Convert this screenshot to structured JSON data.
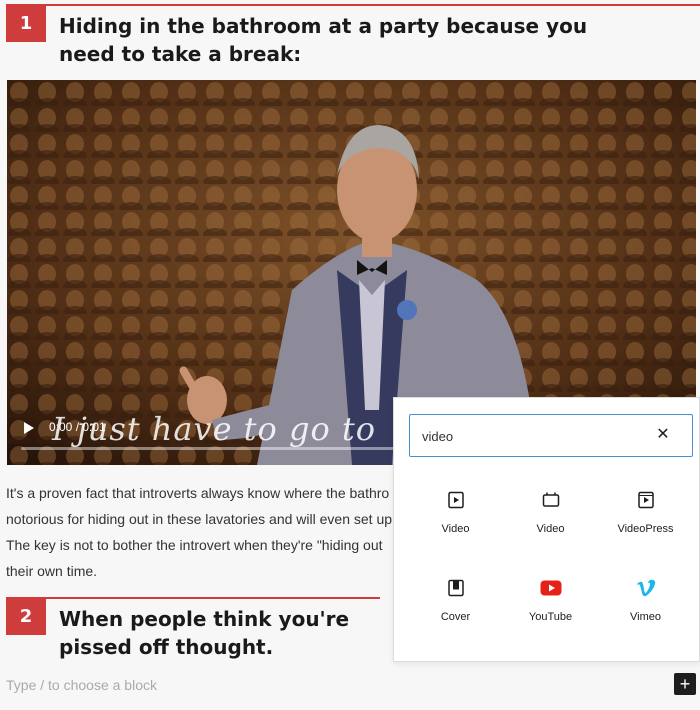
{
  "heading1": {
    "number": "1",
    "title": "Hiding in the bathroom at a party because you need to take a break:"
  },
  "video": {
    "time": "0:00 / 0:01",
    "caption": "I just have to go to"
  },
  "paragraph": {
    "lines": [
      "It's a proven fact that introverts always know where the bathro",
      "notorious for hiding out in these lavatories and will even set up",
      "The key is not to bother the introvert when they're \"hiding out",
      "their own time."
    ]
  },
  "heading2": {
    "number": "2",
    "title": "When people think you're pissed off thought."
  },
  "editor": {
    "placeholder": "Type / to choose a block",
    "add_label": "+"
  },
  "inserter": {
    "search_value": "video",
    "clear_label": "✕",
    "blocks": [
      {
        "label": "Video",
        "icon": "video-icon"
      },
      {
        "label": "Video",
        "icon": "video-embed-icon"
      },
      {
        "label": "VideoPress",
        "icon": "videopress-icon"
      },
      {
        "label": "Cover",
        "icon": "cover-icon"
      },
      {
        "label": "YouTube",
        "icon": "youtube-icon"
      },
      {
        "label": "Vimeo",
        "icon": "vimeo-icon"
      }
    ]
  },
  "colors": {
    "accent": "#cf3c3c",
    "focus": "#4a8fd6",
    "youtube": "#e62117",
    "vimeo": "#1ab7ea"
  }
}
